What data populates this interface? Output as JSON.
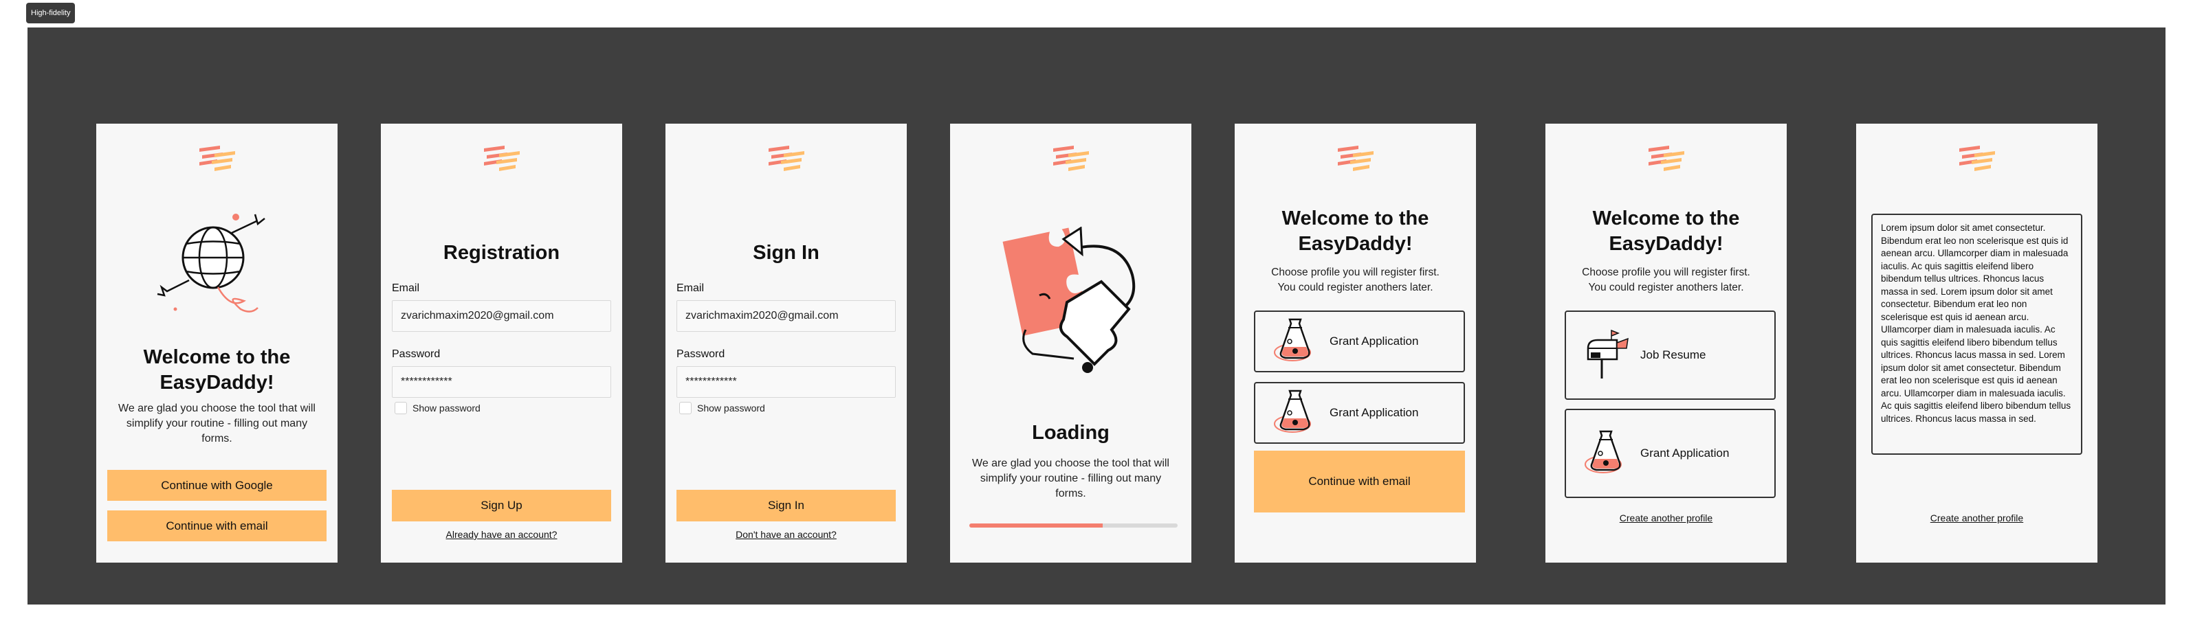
{
  "canvas_tag": "High-fidelity",
  "colors": {
    "accent": "#ffbd6b",
    "brand_red": "#f47f6f",
    "board": "#3f3f3f",
    "screen": "#f7f7f7"
  },
  "screens": {
    "welcome": {
      "title_line1": "Welcome to the",
      "title_line2": "EasyDaddy!",
      "body": "We are glad you choose the tool that will simplify your routine - filling out many forms.",
      "google_button": "Continue with Google",
      "email_button": "Continue with email"
    },
    "registration": {
      "title": "Registration",
      "email_label": "Email",
      "email_value": "zvarichmaxim2020@gmail.com",
      "password_label": "Password",
      "password_value": "************",
      "show_password": "Show password",
      "submit": "Sign Up",
      "link": "Already have an account?"
    },
    "signin": {
      "title": "Sign In",
      "email_label": "Email",
      "email_value": "zvarichmaxim2020@gmail.com",
      "password_label": "Password",
      "password_value": "************",
      "show_password": "Show password",
      "submit": "Sign In",
      "link": "Don't have an account?"
    },
    "loading": {
      "title": "Loading",
      "body": "We are glad you choose the tool that will simplify your routine - filling out many forms.",
      "progress": 0.64
    },
    "profile_select": {
      "title_line1": "Welcome to the",
      "title_line2": "EasyDaddy!",
      "body_line1": "Choose profile you will register first.",
      "body_line2": "You could register anothers later.",
      "option1": "Grant Application",
      "option2": "Grant Application",
      "continue": "Continue with email"
    },
    "profiles": {
      "title_line1": "Welcome to the",
      "title_line2": "EasyDaddy!",
      "body_line1": "Choose profile you will register first.",
      "body_line2": "You could register anothers later.",
      "option1": "Job Resume",
      "option2": "Grant Application",
      "link": "Create another profile"
    },
    "text_profile": {
      "lorem": "Lorem ipsum dolor sit amet consectetur. Bibendum erat leo non scelerisque est quis id aenean arcu. Ullamcorper diam in malesuada iaculis. Ac quis sagittis eleifend libero bibendum tellus ultrices. Rhoncus lacus massa in sed. Lorem ipsum dolor sit amet consectetur. Bibendum erat leo non scelerisque est quis id aenean arcu. Ullamcorper diam in malesuada iaculis. Ac quis sagittis eleifend libero bibendum tellus ultrices. Rhoncus lacus massa in sed. Lorem ipsum dolor sit amet consectetur. Bibendum erat leo non scelerisque est quis id aenean arcu. Ullamcorper diam in malesuada iaculis. Ac quis sagittis eleifend libero bibendum tellus ultrices. Rhoncus lacus massa in sed.",
      "link": "Create another profile"
    }
  },
  "icons": [
    "logo-icon",
    "globe-illustration",
    "puzzle-illustration",
    "flask-icon",
    "mailbox-icon"
  ]
}
